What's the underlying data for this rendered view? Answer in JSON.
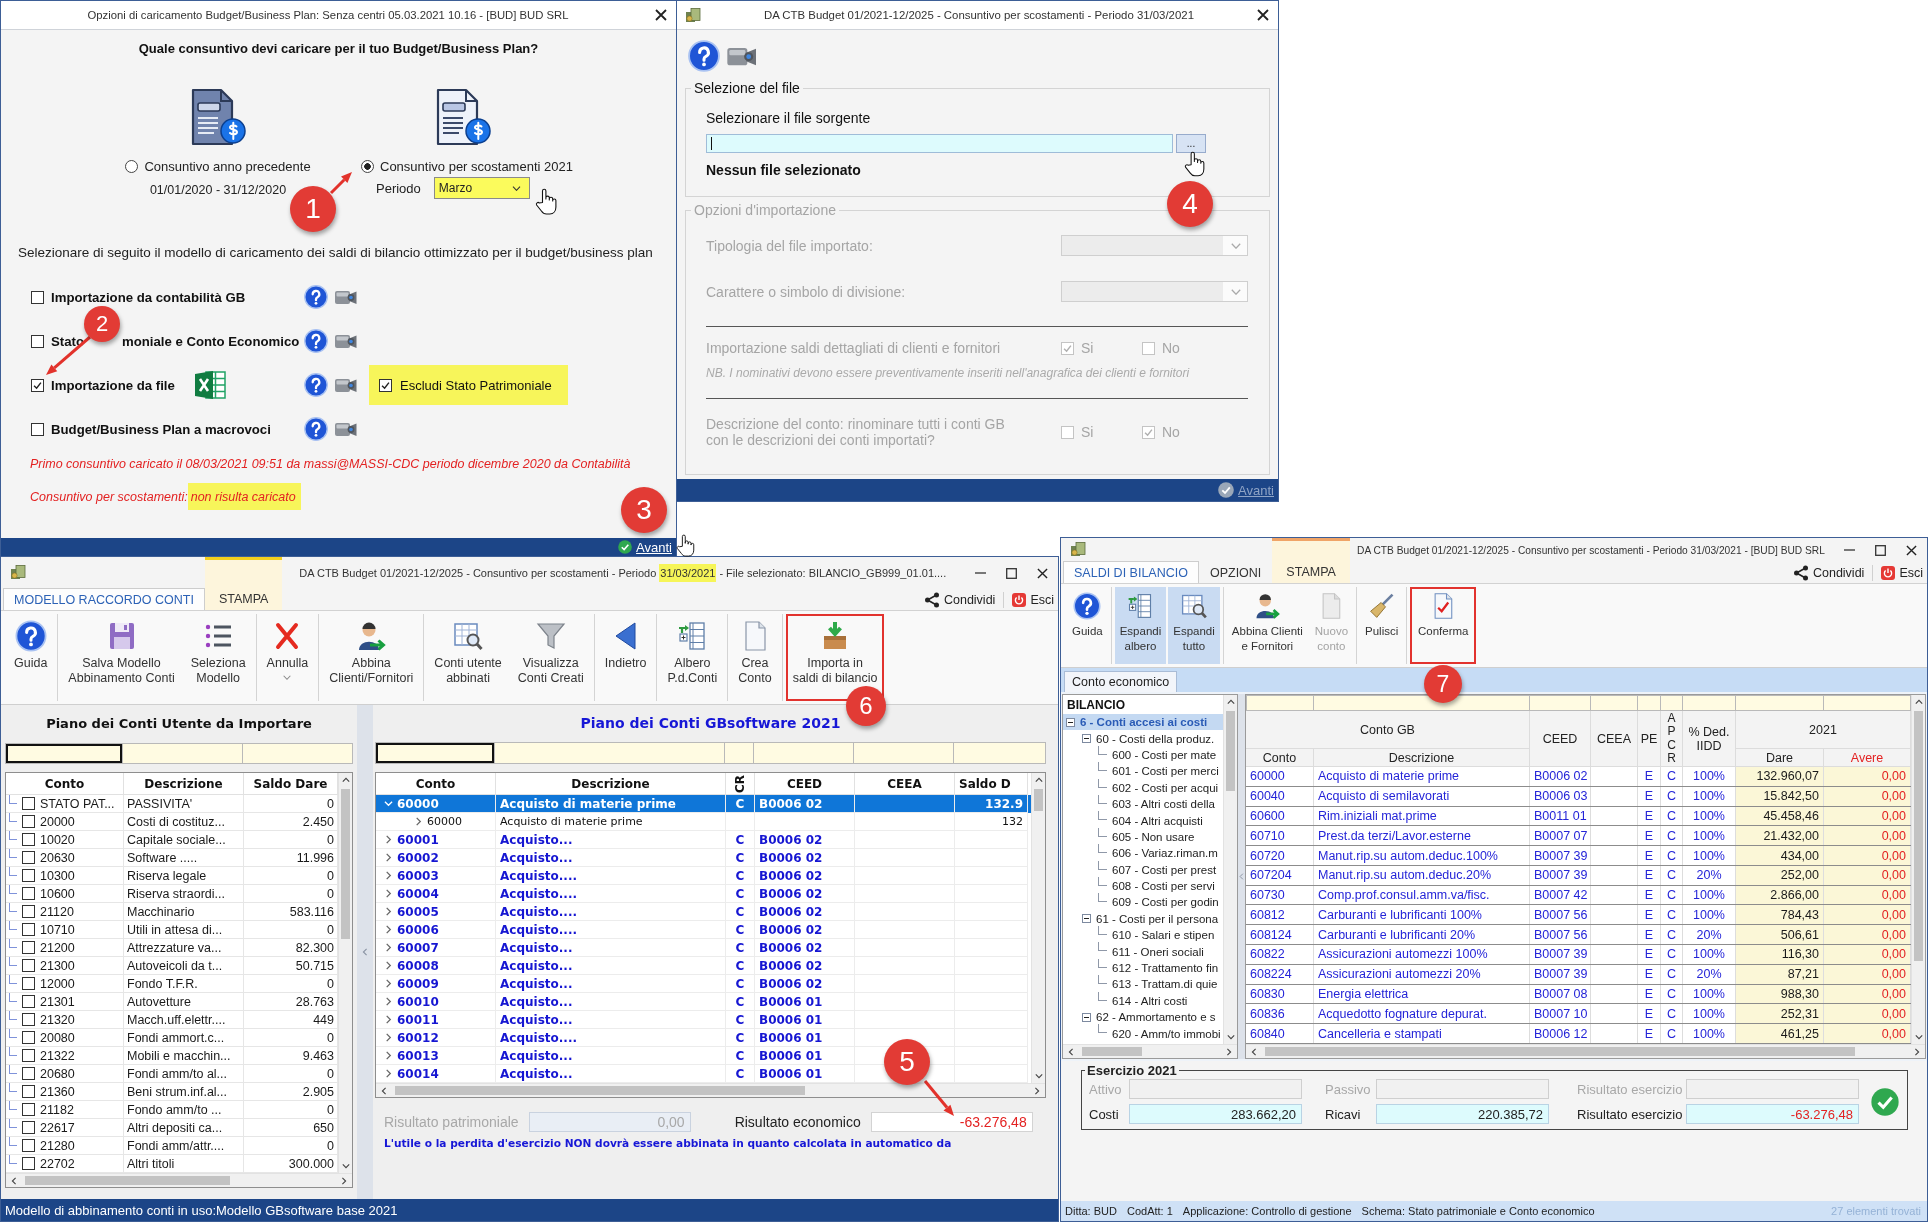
{
  "load_options_dialog": {
    "title": "Opzioni di caricamento Budget/Business Plan: Senza centri 05.03.2021 10.16 - [BUD] BUD SRL",
    "question": "Quale consuntivo devi caricare per il tuo Budget/Business Plan?",
    "choices": [
      {
        "label": "Consuntivo anno precedente",
        "detail": "01/01/2020 - 31/12/2020",
        "selected": false
      },
      {
        "label": "Consuntivo per scostamenti 2021",
        "period": {
          "label": "Periodo",
          "value": "Marzo",
          "highlighted": true
        },
        "selected": true
      }
    ],
    "prompt": "Selezionare di seguito il modello di caricamento dei saldi di bilancio ottimizzato per il budget/business plan",
    "models": [
      {
        "kind": "plain",
        "label_parts": [
          "Importazione da contabilità GB"
        ],
        "checked": false
      },
      {
        "kind": "plain",
        "label_parts": [
          "Stato",
          "moniale e Conto Economico"
        ],
        "checked": false
      },
      {
        "kind": "file",
        "label_parts": [
          "Importazione da file"
        ],
        "checked": true,
        "option": {
          "label": "Escludi Stato Patrimoniale",
          "checked": true,
          "highlighted": true
        }
      },
      {
        "kind": "plain",
        "label_parts": [
          "Budget/Business Plan a macrovoci"
        ],
        "checked": false
      }
    ],
    "history_note": "Primo consuntivo caricato il 08/03/2021 09:51 da massi@MASSI-CDC periodo dicembre 2020 da Contabilità",
    "variance_note": {
      "label": "Consuntivo per scostamenti:",
      "status": "non risulta caricato",
      "highlighted": true
    },
    "next": {
      "label": "Avanti",
      "disabled": false
    }
  },
  "file_import_dialog": {
    "title": "DA CTB Budget 01/2021-12/2025 - Consuntivo per scostamenti - Periodo 31/03/2021",
    "file_group": {
      "legend": "Selezione del file",
      "prompt": "Selezionare il file sorgente",
      "browse": "...",
      "status": "Nessun file selezionato"
    },
    "options_group": {
      "legend": "Opzioni d'importazione",
      "disabled": true,
      "selects": [
        {
          "label": "Tipologia del file importato:"
        },
        {
          "label": "Carattere o simbolo di divisione:"
        }
      ],
      "toggles": [
        {
          "label": "Importazione saldi dettagliati di clienti e fornitori",
          "choices": [
            {
              "label": "Si",
              "checked": true
            },
            {
              "label": "No",
              "checked": false
            }
          ],
          "note": "NB. I nominativi devono essere preventivamente inseriti nell'anagrafica dei clienti e fornitori"
        },
        {
          "label": "Descrizione del conto: rinominare tutti i conti GB\ncon le descrizioni dei conti importati?",
          "choices": [
            {
              "label": "Si",
              "checked": false
            },
            {
              "label": "No",
              "checked": true
            }
          ]
        }
      ]
    },
    "next": {
      "label": "Avanti",
      "disabled": true
    }
  },
  "mapping_window": {
    "title": {
      "text": "DA CTB Budget 01/2021-12/2025 - Consuntivo per scostamenti - Periodo",
      "period": "31/03/2021",
      "period_highlighted": true,
      "file": "- File selezionato: BILANCIO_GB999_01.01...."
    },
    "tabs": [
      {
        "label": "MODELLO RACCORDO CONTI",
        "kind": "main",
        "selected": true
      },
      {
        "label": "STAMPA",
        "kind": "contextual",
        "selected": false
      }
    ],
    "links": [
      {
        "kind": "share",
        "label": "Condividi"
      },
      {
        "kind": "exit",
        "label": "Esci"
      }
    ],
    "toolbar": [
      [
        {
          "kind": "help",
          "label": "Guida",
          "menu": false,
          "highlighted": false,
          "pressed": false,
          "disabled": false
        }
      ],
      [
        {
          "kind": "save",
          "label": "Salva Modello\nAbbinamento Conti",
          "menu": false,
          "highlighted": false,
          "pressed": false,
          "disabled": false
        },
        {
          "kind": "list",
          "label": "Seleziona\nModello",
          "menu": false,
          "highlighted": false,
          "pressed": false,
          "disabled": false
        }
      ],
      [
        {
          "kind": "cancel",
          "label": "Annulla",
          "menu": true,
          "highlighted": false,
          "pressed": false,
          "disabled": false
        }
      ],
      [
        {
          "kind": "person",
          "label": "Abbina\nClienti/Fornitori",
          "menu": false,
          "highlighted": false,
          "pressed": false,
          "disabled": false
        }
      ],
      [
        {
          "kind": "table",
          "label": "Conti utente\nabbinati",
          "menu": false,
          "highlighted": false,
          "pressed": false,
          "disabled": false
        },
        {
          "kind": "filter",
          "label": "Visualizza\nConti Creati",
          "menu": false,
          "highlighted": false,
          "pressed": false,
          "disabled": false
        }
      ],
      [
        {
          "kind": "back",
          "label": "Indietro",
          "menu": false,
          "highlighted": false,
          "pressed": false,
          "disabled": false
        }
      ],
      [
        {
          "kind": "tree",
          "label": "Albero\nP.d.Conti",
          "menu": false,
          "highlighted": false,
          "pressed": false,
          "disabled": false
        }
      ],
      [
        {
          "kind": "page",
          "label": "Crea\nConto",
          "menu": false,
          "highlighted": false,
          "pressed": false,
          "disabled": false
        }
      ],
      [
        {
          "kind": "import",
          "label": "Importa in\nsaldi di bilancio",
          "menu": false,
          "highlighted": true,
          "pressed": false,
          "disabled": false
        }
      ]
    ],
    "user_accounts": {
      "title": "Piano dei Conti Utente da Importare",
      "filters": [
        {
          "focused": true
        },
        {
          "focused": false
        },
        {
          "focused": false
        }
      ],
      "columns": [
        "Conto",
        "Descrizione",
        "Saldo Dare"
      ],
      "rows": [
        {
          "conto": "STATO PAT...",
          "descrizione": "PASSIVITA'",
          "saldo": "0",
          "checked": false
        },
        {
          "conto": "20000",
          "descrizione": "Costi di costituz...",
          "saldo": "2.450",
          "checked": false
        },
        {
          "conto": "10020",
          "descrizione": "Capitale sociale...",
          "saldo": "0",
          "checked": false
        },
        {
          "conto": "20630",
          "descrizione": "Software .....",
          "saldo": "11.996",
          "checked": false
        },
        {
          "conto": "10300",
          "descrizione": "Riserva legale",
          "saldo": "0",
          "checked": false
        },
        {
          "conto": "10600",
          "descrizione": "Riserva straordi...",
          "saldo": "0",
          "checked": false
        },
        {
          "conto": "21120",
          "descrizione": "Macchinario",
          "saldo": "583.116",
          "checked": false
        },
        {
          "conto": "10710",
          "descrizione": "Utili in attesa di...",
          "saldo": "0",
          "checked": false
        },
        {
          "conto": "21200",
          "descrizione": "Attrezzature va...",
          "saldo": "82.300",
          "checked": false
        },
        {
          "conto": "21300",
          "descrizione": "Autoveicoli da t...",
          "saldo": "50.715",
          "checked": false
        },
        {
          "conto": "12000",
          "descrizione": "Fondo T.F.R.",
          "saldo": "0",
          "checked": false
        },
        {
          "conto": "21301",
          "descrizione": "Autovetture",
          "saldo": "28.763",
          "checked": false
        },
        {
          "conto": "21320",
          "descrizione": "Macch.uff.elettr....",
          "saldo": "449",
          "checked": false
        },
        {
          "conto": "20080",
          "descrizione": "Fondi ammort.c...",
          "saldo": "0",
          "checked": false
        },
        {
          "conto": "21322",
          "descrizione": "Mobili e macchin...",
          "saldo": "9.463",
          "checked": false
        },
        {
          "conto": "20680",
          "descrizione": "Fondi amm/to al...",
          "saldo": "0",
          "checked": false
        },
        {
          "conto": "21360",
          "descrizione": "Beni strum.inf.al...",
          "saldo": "2.905",
          "checked": false
        },
        {
          "conto": "21182",
          "descrizione": "Fondo amm/to ...",
          "saldo": "0",
          "checked": false
        },
        {
          "conto": "22617",
          "descrizione": "Altri depositi ca...",
          "saldo": "650",
          "checked": false
        },
        {
          "conto": "21280",
          "descrizione": "Fondi amm/attr....",
          "saldo": "0",
          "checked": false
        },
        {
          "conto": "22702",
          "descrizione": "Altri titoli",
          "saldo": "300.000",
          "checked": false
        }
      ]
    },
    "gb_accounts": {
      "title": "Piano dei Conti GBsoftware 2021",
      "filters": [
        {
          "focused": true
        },
        {
          "focused": false
        },
        {
          "focused": false
        },
        {
          "focused": false
        },
        {
          "focused": false
        },
        {
          "focused": false
        }
      ],
      "columns": [
        {
          "label": "Conto",
          "kind": "plain"
        },
        {
          "label": "Descrizione",
          "kind": "plain"
        },
        {
          "label": "CR",
          "kind": "rotated"
        },
        {
          "label": "CEED",
          "kind": "plain"
        },
        {
          "label": "CEEA",
          "kind": "plain"
        },
        {
          "label": "Saldo D",
          "kind": "plain"
        }
      ],
      "rows": [
        {
          "conto": "60000",
          "descrizione": "Acquisto di materie prime",
          "cr": "C",
          "ceed": "B0006 02",
          "saldo": "132.9",
          "selected": true,
          "expanded": true,
          "children": [
            {
              "conto": "60000",
              "descrizione": "Acquisto di materie prime",
              "saldo": "132",
              "selected": false,
              "expanded": false
            }
          ]
        },
        {
          "conto": "60001",
          "descrizione": "Acquisto...",
          "cr": "C",
          "ceed": "B0006 02",
          "selected": false,
          "expanded": false
        },
        {
          "conto": "60002",
          "descrizione": "Acquisto...",
          "cr": "C",
          "ceed": "B0006 02",
          "selected": false,
          "expanded": false
        },
        {
          "conto": "60003",
          "descrizione": "Acquisto....",
          "cr": "C",
          "ceed": "B0006 02",
          "selected": false,
          "expanded": false
        },
        {
          "conto": "60004",
          "descrizione": "Acquisto....",
          "cr": "C",
          "ceed": "B0006 02",
          "selected": false,
          "expanded": false
        },
        {
          "conto": "60005",
          "descrizione": "Acquisto....",
          "cr": "C",
          "ceed": "B0006 02",
          "selected": false,
          "expanded": false
        },
        {
          "conto": "60006",
          "descrizione": "Acquisto....",
          "cr": "C",
          "ceed": "B0006 02",
          "selected": false,
          "expanded": false
        },
        {
          "conto": "60007",
          "descrizione": "Acquisto...",
          "cr": "C",
          "ceed": "B0006 02",
          "selected": false,
          "expanded": false
        },
        {
          "conto": "60008",
          "descrizione": "Acquisto...",
          "cr": "C",
          "ceed": "B0006 02",
          "selected": false,
          "expanded": false
        },
        {
          "conto": "60009",
          "descrizione": "Acquisto...",
          "cr": "C",
          "ceed": "B0006 02",
          "selected": false,
          "expanded": false
        },
        {
          "conto": "60010",
          "descrizione": "Acquisto...",
          "cr": "C",
          "ceed": "B0006 01",
          "selected": false,
          "expanded": false
        },
        {
          "conto": "60011",
          "descrizione": "Acquisto...",
          "cr": "C",
          "ceed": "B0006 01",
          "selected": false,
          "expanded": false
        },
        {
          "conto": "60012",
          "descrizione": "Acquisto....",
          "cr": "C",
          "ceed": "B0006 01",
          "selected": false,
          "expanded": false
        },
        {
          "conto": "60013",
          "descrizione": "Acquisto...",
          "cr": "C",
          "ceed": "B0006 01",
          "selected": false,
          "expanded": false
        },
        {
          "conto": "60014",
          "descrizione": "Acquisto...",
          "cr": "C",
          "ceed": "B0006 01",
          "selected": false,
          "expanded": false
        }
      ]
    },
    "results": [
      {
        "label": "Risultato patrimoniale",
        "value": "0,00",
        "disabled": true,
        "negative": false
      },
      {
        "label": "Risultato economico",
        "value": "-63.276,48",
        "disabled": false,
        "negative": true
      }
    ],
    "note": "L'utile o la perdita d'esercizio NON dovrà essere abbinata in quanto calcolata in automatico da",
    "status": "Modello di abbinamento conti in uso:Modello GBsoftware base 2021"
  },
  "balance_window": {
    "title": "DA CTB Budget 01/2021-12/2025 - Consuntivo per scostamenti - Periodo 31/03/2021 - [BUD] BUD SRL",
    "tabs": [
      {
        "label": "SALDI DI BILANCIO",
        "kind": "main",
        "selected": true
      },
      {
        "label": "OPZIONI",
        "kind": "main",
        "selected": false
      },
      {
        "label": "STAMPA",
        "kind": "contextual",
        "selected": false
      }
    ],
    "links": [
      {
        "kind": "share",
        "label": "Condividi"
      },
      {
        "kind": "exit",
        "label": "Esci"
      }
    ],
    "toolbar": [
      [
        {
          "kind": "help",
          "label": "Guida",
          "menu": false,
          "highlighted": false,
          "pressed": false,
          "disabled": false
        }
      ],
      [
        {
          "kind": "expand",
          "label": "Espandi\nalbero",
          "menu": false,
          "highlighted": false,
          "pressed": true,
          "disabled": false
        },
        {
          "kind": "expand_all",
          "label": "Espandi\ntutto",
          "menu": false,
          "highlighted": false,
          "pressed": true,
          "disabled": false
        }
      ],
      [
        {
          "kind": "person",
          "label": "Abbina Clienti\ne Fornitori",
          "menu": false,
          "highlighted": false,
          "pressed": false,
          "disabled": false
        },
        {
          "kind": "page",
          "label": "Nuovo\nconto",
          "menu": false,
          "highlighted": false,
          "pressed": false,
          "disabled": true
        }
      ],
      [
        {
          "kind": "broom",
          "label": "Pulisci",
          "menu": false,
          "highlighted": false,
          "pressed": false,
          "disabled": false
        }
      ],
      [
        {
          "kind": "confirm",
          "label": "Conferma",
          "menu": false,
          "highlighted": true,
          "pressed": false,
          "disabled": false
        }
      ]
    ],
    "sheet_tabs": [
      {
        "label": "Conto economico",
        "selected": true
      }
    ],
    "tree": {
      "title": "BILANCIO",
      "nodes": [
        {
          "label": "6 - Conti accesi ai costi",
          "selected": true,
          "expanded": true,
          "children": [
            {
              "label": "60 - Costi della produz.",
              "selected": false,
              "expanded": true,
              "children": [
                {
                  "label": "600 - Costi per mate",
                  "selected": false
                },
                {
                  "label": "601 - Costi per merci",
                  "selected": false
                },
                {
                  "label": "602 - Costi per acqui",
                  "selected": false
                },
                {
                  "label": "603 - Altri costi della",
                  "selected": false
                },
                {
                  "label": "604 - Altri acquisti",
                  "selected": false
                },
                {
                  "label": "605 - Non usare",
                  "selected": false
                },
                {
                  "label": "606 - Variaz.riman.m",
                  "selected": false
                },
                {
                  "label": "607 - Costi per prest",
                  "selected": false
                },
                {
                  "label": "608 - Costi per servi",
                  "selected": false
                },
                {
                  "label": "609 - Costi per godin",
                  "selected": false
                }
              ]
            },
            {
              "label": "61 - Costi per il persona",
              "selected": false,
              "expanded": true,
              "children": [
                {
                  "label": "610 - Salari e stipen",
                  "selected": false
                },
                {
                  "label": "611 - Oneri sociali",
                  "selected": false
                },
                {
                  "label": "612 - Trattamento fin",
                  "selected": false
                },
                {
                  "label": "613 - Trattam.di quie",
                  "selected": false
                },
                {
                  "label": "614 - Altri costi",
                  "selected": false
                }
              ]
            },
            {
              "label": "62 - Ammortamento e s",
              "selected": false,
              "expanded": true,
              "children": [
                {
                  "label": "620 - Amm/to immobi",
                  "selected": false
                }
              ]
            }
          ]
        }
      ]
    },
    "grid": {
      "filters": [
        {
          "focused": false
        },
        {
          "focused": false
        },
        {
          "focused": false
        },
        {
          "focused": false
        },
        {
          "focused": false
        },
        {
          "focused": false
        },
        {
          "focused": false
        },
        {
          "focused": false
        },
        {
          "focused": false
        }
      ],
      "header": [
        {
          "label": "Conto GB",
          "kind": "plain",
          "children": [
            {
              "label": "Conto",
              "kind": "text"
            },
            {
              "label": "Descrizione",
              "kind": "text"
            }
          ]
        },
        {
          "label": "CEED",
          "kind": "plain"
        },
        {
          "label": "CEEA",
          "kind": "plain"
        },
        {
          "label": "PE",
          "kind": "plain"
        },
        {
          "label": "APCR",
          "kind": "stacked"
        },
        {
          "label": "% Ded.\nIIDD",
          "kind": "plain"
        },
        {
          "label": "2021",
          "kind": "plain",
          "children": [
            {
              "label": "Dare",
              "kind": "debit"
            },
            {
              "label": "Avere",
              "kind": "credit"
            }
          ]
        }
      ],
      "rows": [
        {
          "conto": "60000",
          "descrizione": "Acquisto di materie prime",
          "ceed": "B0006 02",
          "pe": "E",
          "apcr": "C",
          "ded": "100%",
          "dare": "132.960,07",
          "avere": "0,00"
        },
        {
          "conto": "60040",
          "descrizione": "Acquisto di semilavorati",
          "ceed": "B0006 03",
          "pe": "E",
          "apcr": "C",
          "ded": "100%",
          "dare": "15.842,50",
          "avere": "0,00"
        },
        {
          "conto": "60600",
          "descrizione": "Rim.iniziali mat.prime",
          "ceed": "B0011 01",
          "pe": "E",
          "apcr": "C",
          "ded": "100%",
          "dare": "45.458,46",
          "avere": "0,00"
        },
        {
          "conto": "60710",
          "descrizione": "Prest.da terzi/Lavor.esterne",
          "ceed": "B0007 07",
          "pe": "E",
          "apcr": "C",
          "ded": "100%",
          "dare": "21.432,00",
          "avere": "0,00"
        },
        {
          "conto": "60720",
          "descrizione": "Manut.rip.su autom.deduc.100%",
          "ceed": "B0007 39",
          "pe": "E",
          "apcr": "C",
          "ded": "100%",
          "dare": "434,00",
          "avere": "0,00"
        },
        {
          "conto": "607204",
          "descrizione": "Manut.rip.su autom.deduc.20%",
          "ceed": "B0007 39",
          "pe": "E",
          "apcr": "C",
          "ded": "20%",
          "dare": "252,00",
          "avere": "0,00"
        },
        {
          "conto": "60730",
          "descrizione": "Comp.prof.consul.amm.va/fisc.",
          "ceed": "B0007 42",
          "pe": "E",
          "apcr": "C",
          "ded": "100%",
          "dare": "2.866,00",
          "avere": "0,00"
        },
        {
          "conto": "60812",
          "descrizione": "Carburanti e lubrificanti 100%",
          "ceed": "B0007 56",
          "pe": "E",
          "apcr": "C",
          "ded": "100%",
          "dare": "784,43",
          "avere": "0,00"
        },
        {
          "conto": "608124",
          "descrizione": "Carburanti e lubrificanti 20%",
          "ceed": "B0007 56",
          "pe": "E",
          "apcr": "C",
          "ded": "20%",
          "dare": "506,61",
          "avere": "0,00"
        },
        {
          "conto": "60822",
          "descrizione": "Assicurazioni automezzi 100%",
          "ceed": "B0007 39",
          "pe": "E",
          "apcr": "C",
          "ded": "100%",
          "dare": "116,30",
          "avere": "0,00"
        },
        {
          "conto": "608224",
          "descrizione": "Assicurazioni automezzi 20%",
          "ceed": "B0007 39",
          "pe": "E",
          "apcr": "C",
          "ded": "20%",
          "dare": "87,21",
          "avere": "0,00"
        },
        {
          "conto": "60830",
          "descrizione": "Energia elettrica",
          "ceed": "B0007 08",
          "pe": "E",
          "apcr": "C",
          "ded": "100%",
          "dare": "988,30",
          "avere": "0,00"
        },
        {
          "conto": "60836",
          "descrizione": "Acquedotto fognature depurat.",
          "ceed": "B0007 10",
          "pe": "E",
          "apcr": "C",
          "ded": "100%",
          "dare": "252,31",
          "avere": "0,00"
        },
        {
          "conto": "60840",
          "descrizione": "Cancelleria e stampati",
          "ceed": "B0006 12",
          "pe": "E",
          "apcr": "C",
          "ded": "100%",
          "dare": "461,25",
          "avere": "0,00"
        }
      ]
    },
    "summary": {
      "title": "Esercizio 2021",
      "rows": [
        [
          {
            "label": "Attivo",
            "disabled": true
          },
          {
            "label": "Passivo",
            "disabled": true
          },
          {
            "label": "Risultato esercizio",
            "disabled": true
          }
        ],
        [
          {
            "label": "Costi",
            "value": "283.662,20",
            "disabled": false,
            "negative": false
          },
          {
            "label": "Ricavi",
            "value": "220.385,72",
            "disabled": false,
            "negative": false
          },
          {
            "label": "Risultato esercizio",
            "value": "-63.276,48",
            "disabled": false,
            "negative": true
          }
        ]
      ]
    },
    "status_items": [
      "Ditta: BUD",
      "CodAtt: 1",
      "Applicazione: Controllo di gestione",
      "Schema: Stato patrimoniale e Conto economico"
    ],
    "result_count": "27 elementi trovati"
  },
  "annotations": [
    {
      "label": "1",
      "arrow": true
    },
    {
      "label": "2",
      "arrow": true
    },
    {
      "label": "3",
      "arrow": false
    },
    {
      "label": "4",
      "arrow": false
    },
    {
      "label": "5",
      "arrow": true
    },
    {
      "label": "6",
      "arrow": false
    },
    {
      "label": "7",
      "arrow": false
    }
  ]
}
